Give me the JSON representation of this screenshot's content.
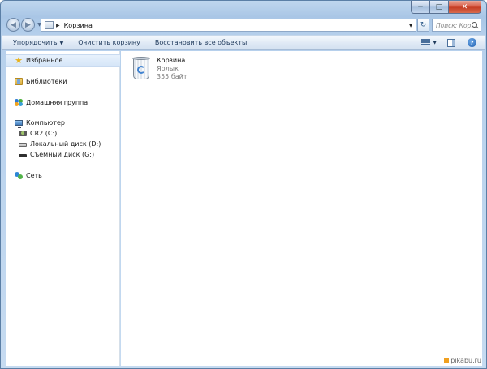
{
  "window": {
    "caption": {
      "minimize": "─",
      "maximize": "□",
      "close": "✕"
    }
  },
  "address_bar": {
    "path": "Корзина",
    "search_placeholder": "Поиск: Кор..."
  },
  "toolbar": {
    "organize": "Упорядочить",
    "empty_bin": "Очистить корзину",
    "restore_all": "Восстановить все объекты"
  },
  "navigation_pane": {
    "favorites": "Избранное",
    "libraries": "Библиотеки",
    "homegroup": "Домашняя группа",
    "computer": "Компьютер",
    "drives": [
      {
        "label": "CR2 (C:)",
        "icon": "camera-drive-icon"
      },
      {
        "label": "Локальный диск (D:)",
        "icon": "local-disk-icon"
      },
      {
        "label": "Съемный диск (G:)",
        "icon": "removable-disk-icon"
      }
    ],
    "network": "Сеть"
  },
  "content": {
    "items": [
      {
        "name": "Корзина",
        "type": "Ярлык",
        "size": "355 байт",
        "icon": "recycle-bin-icon"
      }
    ]
  },
  "watermark": "pikabu.ru"
}
